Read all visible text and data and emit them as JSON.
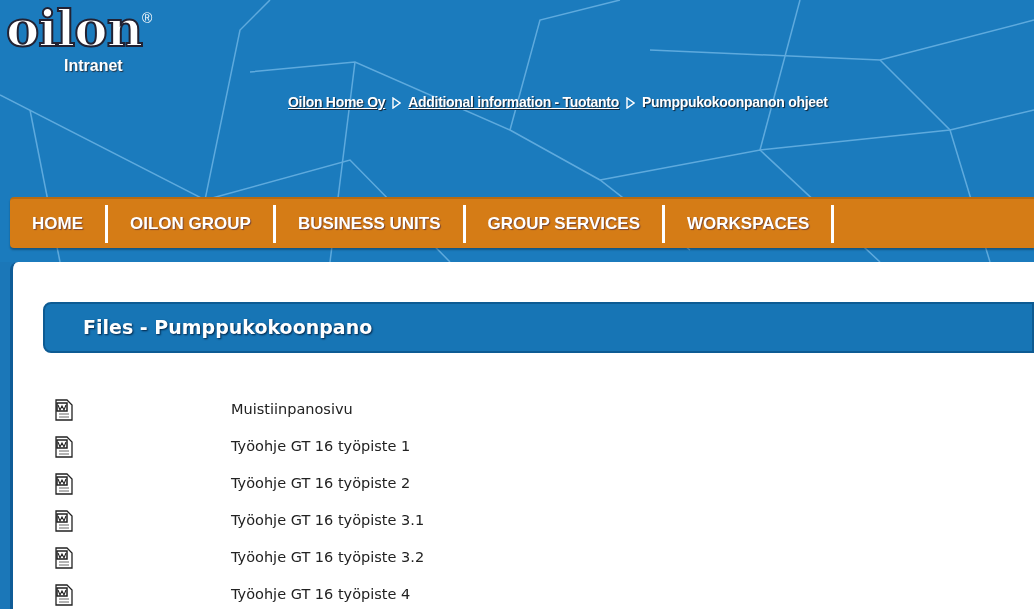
{
  "header": {
    "logo": "oilon",
    "registered": "®",
    "subtitle": "Intranet"
  },
  "breadcrumb": [
    {
      "label": "Oilon Home Oy",
      "kind": "link"
    },
    {
      "label": "Additional information - Tuotanto",
      "kind": "link"
    },
    {
      "label": "Pumppukokoonpanon ohjeet",
      "kind": "current"
    }
  ],
  "nav": [
    "HOME",
    "OILON GROUP",
    "BUSINESS UNITS",
    "GROUP SERVICES",
    "WORKSPACES"
  ],
  "files": {
    "title": "Files - Pumppukokoonpano",
    "items": [
      "Muistiinpanosivu",
      "Työohje GT 16 työpiste 1",
      "Työohje GT 16 työpiste 2",
      "Työohje GT 16 työpiste 3.1",
      "Työohje GT 16 työpiste 3.2",
      "Työohje GT 16 työpiste 4"
    ]
  }
}
